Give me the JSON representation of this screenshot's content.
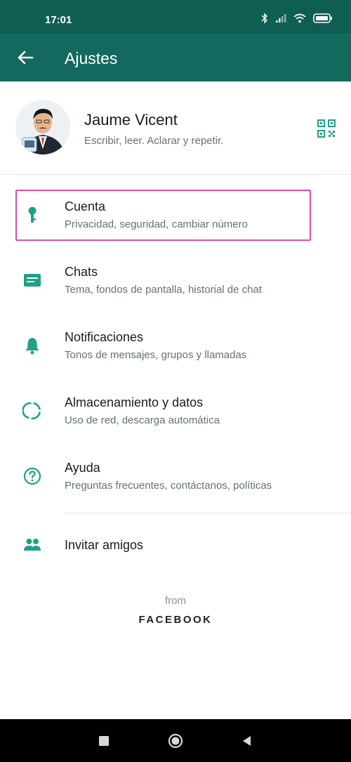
{
  "status_bar": {
    "time": "17:01"
  },
  "app_bar": {
    "title": "Ajustes"
  },
  "profile": {
    "name": "Jaume Vicent",
    "status": "Escribir, leer. Aclarar y repetir."
  },
  "menu": [
    {
      "title": "Cuenta",
      "subtitle": "Privacidad, seguridad, cambiar número",
      "icon": "key-icon"
    },
    {
      "title": "Chats",
      "subtitle": "Tema, fondos de pantalla, historial de chat",
      "icon": "chat-icon"
    },
    {
      "title": "Notificaciones",
      "subtitle": "Tonos de mensajes, grupos y llamadas",
      "icon": "bell-icon"
    },
    {
      "title": "Almacenamiento y datos",
      "subtitle": "Uso de red, descarga automática",
      "icon": "data-usage-icon"
    },
    {
      "title": "Ayuda",
      "subtitle": "Preguntas frecuentes, contáctanos, políticas",
      "icon": "help-icon"
    }
  ],
  "invite": {
    "label": "Invitar amigos",
    "icon": "group-icon"
  },
  "footer": {
    "from": "from",
    "brand": "FACEBOOK"
  },
  "colors": {
    "status_bar": "#0f5e54",
    "app_bar": "#13695d",
    "icon": "#1fa187",
    "highlight_border": "#d64fb1"
  }
}
